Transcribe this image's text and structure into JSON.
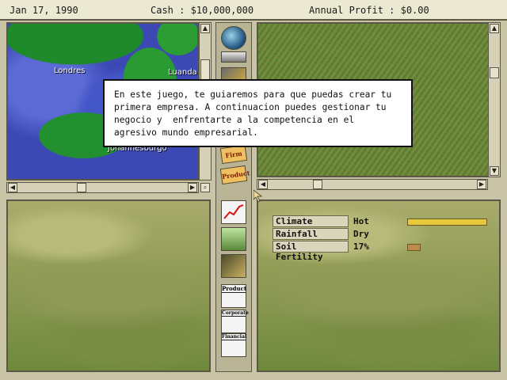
{
  "status_bar": {
    "date": "Jan 17, 1990",
    "cash": "Cash : $10,000,000",
    "annual_profit": "Annual Profit : $0.00"
  },
  "map": {
    "cities": [
      "Londres",
      "Luanda",
      "Johannesburgo"
    ]
  },
  "toolbar_top": {
    "items": [
      {
        "icon": "globe-icon"
      },
      {
        "icon": "cutter-icon"
      },
      {
        "icon": "tools-icon"
      },
      {
        "label": "Firm",
        "icon": "firm-tag-icon"
      },
      {
        "label": "Product",
        "icon": "product-tag-icon"
      }
    ]
  },
  "toolbar_bottom": {
    "items": [
      {
        "icon": "chart-icon"
      },
      {
        "icon": "factory-icon"
      },
      {
        "icon": "crate-icon"
      },
      {
        "label": "Product",
        "icon": "product-report-icon"
      },
      {
        "label": "Corporate",
        "icon": "corporate-report-icon"
      },
      {
        "label": "Financial",
        "icon": "financial-report-icon"
      }
    ]
  },
  "land_info": {
    "rows": [
      {
        "label": "Climate",
        "value": "Hot",
        "level": 1.0,
        "color": "#e6c93a"
      },
      {
        "label": "Rainfall",
        "value": "Dry",
        "level": 0,
        "color": "#e6c93a"
      },
      {
        "label": "Soil Fertility",
        "value": "17%",
        "level": 0.17,
        "color": "#c08a4a"
      }
    ]
  },
  "dialog": {
    "text": "En este juego, te guiaremos para que puedas crear tu\nprimera empresa. A continuacion puedes gestionar tu\nnegocio y  enfrentarte a la competencia en el\nagresivo mundo empresarial."
  }
}
